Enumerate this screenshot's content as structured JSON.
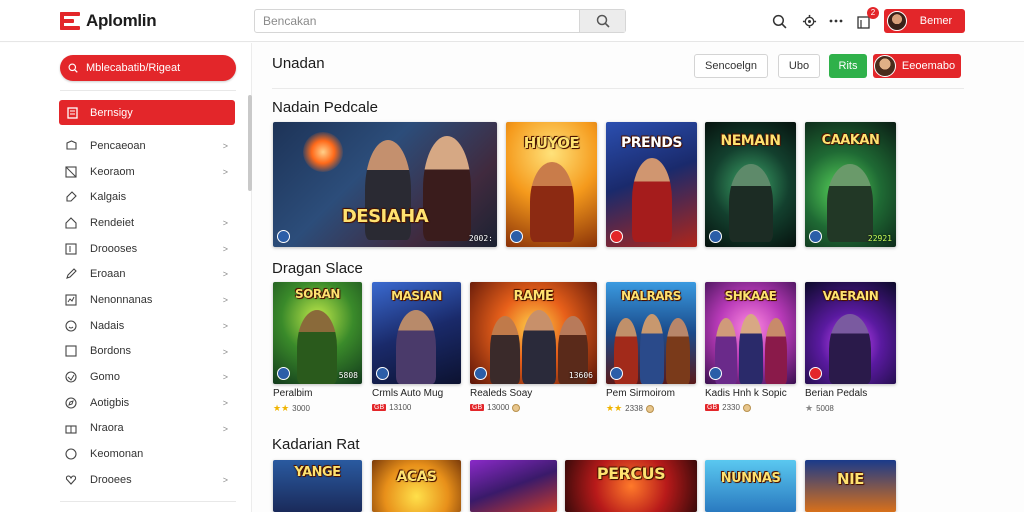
{
  "app": {
    "logo_text": "Aplomlin"
  },
  "search": {
    "placeholder": "Bencakan"
  },
  "topbar": {
    "notifications_badge": "2",
    "profile_label": "Bemer"
  },
  "sidebar": {
    "primary_button": "Mblecabatib/Rigeat",
    "active_item": "Bernsigy",
    "items": [
      {
        "label": "Pencaeoan",
        "icon": "gamepad-icon"
      },
      {
        "label": "Keoraom",
        "icon": "grid-icon"
      },
      {
        "label": "Kalgais",
        "icon": "tag-icon"
      },
      {
        "label": "Rendeiet",
        "icon": "home-icon"
      },
      {
        "label": "Droooses",
        "icon": "book-icon"
      },
      {
        "label": "Eroaan",
        "icon": "pencil-icon"
      },
      {
        "label": "Nenonnanas",
        "icon": "chart-icon"
      },
      {
        "label": "Nadais",
        "icon": "smile-icon"
      },
      {
        "label": "Bordons",
        "icon": "square-icon"
      },
      {
        "label": "Gomo",
        "icon": "globe-icon"
      },
      {
        "label": "Aotigbis",
        "icon": "compass-icon"
      },
      {
        "label": "Nraora",
        "icon": "gift-icon"
      },
      {
        "label": "Keomonan",
        "icon": "circle-icon"
      },
      {
        "label": "Drooees",
        "icon": "heart-icon"
      }
    ]
  },
  "main": {
    "header": "Unadan",
    "buttons": {
      "secondary": "Sencoelgn",
      "tertiary": "Ubo",
      "green": "Rits",
      "user": "Eeoemabo"
    },
    "sections": [
      {
        "title": "Nadain Pedcale",
        "tiles": [
          {
            "art": "DESIAHA",
            "num": "2002:",
            "dot": "#2b5ea8"
          },
          {
            "art": "HUYOE",
            "num": "",
            "dot": "#2b5ea8"
          },
          {
            "art": "PRENDS",
            "num": "",
            "dot": "#e3262a"
          },
          {
            "art": "NEMAIN",
            "num": "",
            "dot": "#2b5ea8"
          },
          {
            "art": "CAAKAN",
            "num": "22921",
            "dot": "#2b5ea8"
          }
        ]
      },
      {
        "title": "Dragan Slace",
        "tiles": [
          {
            "art": "SORAN",
            "num": "5808",
            "dot": "#2b5ea8",
            "caption": "Peralbim",
            "meta": "3000",
            "meta_style": "stars"
          },
          {
            "art": "MASIAN",
            "num": "",
            "dot": "#2b5ea8",
            "caption": "Crmls Auto Mug",
            "meta": "13100",
            "meta_style": "tag"
          },
          {
            "art": "RAME",
            "num": "13606",
            "dot": "#2b5ea8",
            "caption": "Realeds Soay",
            "meta": "13000",
            "meta_style": "tag"
          },
          {
            "art": "NALRARS",
            "num": "",
            "dot": "#2b5ea8",
            "caption": "Pem Sirmoirom",
            "meta": "2338",
            "meta_style": "stars"
          },
          {
            "art": "SHKAAE",
            "num": "",
            "dot": "#2b5ea8",
            "caption": "Kadis Hnh k Sopic",
            "meta": "2330",
            "meta_style": "tag"
          },
          {
            "art": "VAERAIN",
            "num": "",
            "dot": "#e3262a",
            "caption": "Berian Pedals",
            "meta": "5008",
            "meta_style": "plain"
          }
        ]
      },
      {
        "title": "Kadarian Rat",
        "tiles": [
          {
            "art": "YANGE"
          },
          {
            "art": "ACAS"
          },
          {
            "art": ""
          },
          {
            "art": "PERCUS"
          },
          {
            "art": "NUNNAS"
          },
          {
            "art": "NIE"
          }
        ]
      }
    ]
  },
  "colors": {
    "accent": "#e3262a",
    "green": "#2fb14a"
  }
}
